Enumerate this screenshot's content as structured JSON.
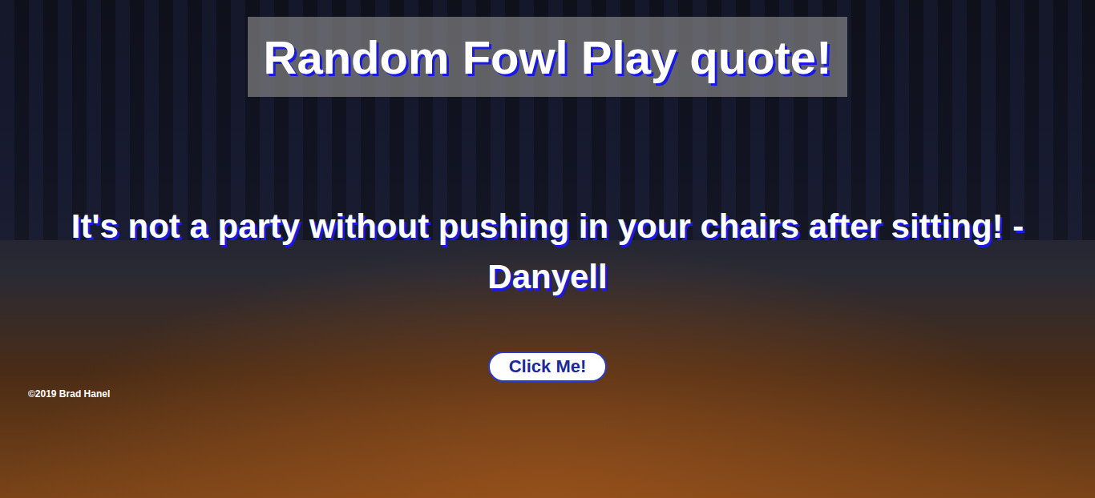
{
  "page": {
    "title": "Random Fowl Play quote!"
  },
  "quote": {
    "text": "It's not a party without pushing in your chairs after sitting! - Danyell"
  },
  "button": {
    "label": "Click Me!"
  },
  "footer": {
    "copyright": "©2019 Brad Hanel"
  }
}
